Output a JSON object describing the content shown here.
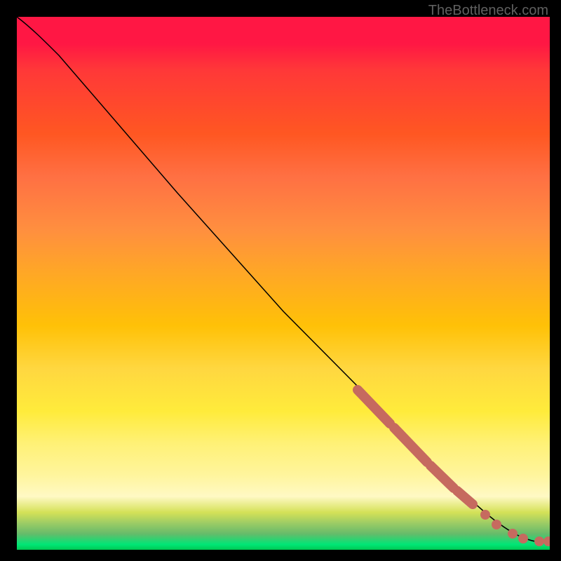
{
  "watermark": "TheBottleneck.com",
  "chart_data": {
    "type": "line",
    "title": "",
    "xlabel": "",
    "ylabel": "",
    "xlim": [
      0,
      100
    ],
    "ylim": [
      0,
      100
    ],
    "series": [
      {
        "name": "curve",
        "x": [
          0,
          5,
          10,
          15,
          20,
          25,
          30,
          35,
          40,
          45,
          50,
          55,
          60,
          65,
          70,
          75,
          80,
          85,
          90,
          92,
          94,
          96,
          98,
          100
        ],
        "values": [
          100,
          97,
          93,
          88,
          82,
          76,
          70,
          64,
          58,
          52,
          46,
          40,
          34,
          28,
          23,
          18,
          13,
          9,
          5,
          4,
          3,
          2.5,
          2,
          2
        ]
      }
    ],
    "highlight_segments": [
      {
        "x_start": 64,
        "x_end": 70,
        "y_start": 30,
        "y_end": 25
      },
      {
        "x_start": 70,
        "x_end": 77,
        "y_start": 25,
        "y_end": 17
      },
      {
        "x_start": 77,
        "x_end": 82,
        "y_start": 17,
        "y_end": 12
      },
      {
        "x_start": 82,
        "x_end": 85,
        "y_start": 12,
        "y_end": 9
      }
    ],
    "highlight_points": [
      {
        "x": 88,
        "y": 6
      },
      {
        "x": 90,
        "y": 4.5
      },
      {
        "x": 93,
        "y": 3
      },
      {
        "x": 95,
        "y": 2.5
      },
      {
        "x": 98,
        "y": 2
      },
      {
        "x": 100,
        "y": 2
      }
    ],
    "grid": false,
    "legend": false
  },
  "colors": {
    "background": "#000000",
    "gradient_top": "#ff1744",
    "gradient_mid": "#ffeb3b",
    "gradient_bottom": "#00c853",
    "curve": "#000000",
    "highlight": "#c66a5f",
    "watermark": "#606060"
  }
}
